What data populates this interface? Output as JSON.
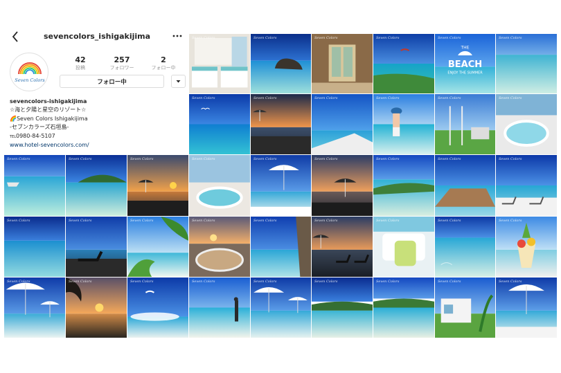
{
  "profile": {
    "username": "sevencolors_ishigakijima",
    "avatar_text": "Seven Colors",
    "stats": [
      {
        "value": "42",
        "label": "投稿"
      },
      {
        "value": "257",
        "label": "フォロワー"
      },
      {
        "value": "2",
        "label": "フォロー中"
      }
    ],
    "follow_button": "フォロー中",
    "bio": {
      "name": "sevencolors-ishigakijima",
      "lines": [
        "☆海と夕陽と星空のリゾート☆",
        "🌈Seven Colors Ishigakijima",
        "-セブンカラーズ石垣島-"
      ],
      "tel_label": "TEL",
      "tel": "0980-84-5107",
      "url": "www.hotel-sevencolors.com/"
    }
  },
  "grid": {
    "watermark": "Seven Colors",
    "tiles": [
      {
        "kind": "room"
      },
      {
        "kind": "rock"
      },
      {
        "kind": "interior"
      },
      {
        "kind": "coast"
      },
      {
        "kind": "beachlogo",
        "logo_line1": "THE",
        "logo_line2": "BEACH",
        "logo_line3": "ENJOY THE SUMMER"
      },
      {
        "kind": "shallow"
      },
      {
        "kind": "birds"
      },
      {
        "kind": "dusk"
      },
      {
        "kind": "terrace"
      },
      {
        "kind": "girl"
      },
      {
        "kind": "swing"
      },
      {
        "kind": "jacuzzi"
      },
      {
        "kind": "jetski"
      },
      {
        "kind": "island"
      },
      {
        "kind": "sunset"
      },
      {
        "kind": "pool"
      },
      {
        "kind": "umbrella"
      },
      {
        "kind": "sunsetumbrella"
      },
      {
        "kind": "beach"
      },
      {
        "kind": "deck"
      },
      {
        "kind": "loungers"
      },
      {
        "kind": "sea"
      },
      {
        "kind": "lounger"
      },
      {
        "kind": "palm"
      },
      {
        "kind": "poolsunset"
      },
      {
        "kind": "cliff"
      },
      {
        "kind": "duskchairs"
      },
      {
        "kind": "cushions"
      },
      {
        "kind": "clearwater"
      },
      {
        "kind": "parfait"
      },
      {
        "kind": "parasol"
      },
      {
        "kind": "palmsunset"
      },
      {
        "kind": "kite"
      },
      {
        "kind": "walker"
      },
      {
        "kind": "parasol2"
      },
      {
        "kind": "lagoon"
      },
      {
        "kind": "shore"
      },
      {
        "kind": "villa"
      },
      {
        "kind": "parasol3"
      }
    ]
  }
}
